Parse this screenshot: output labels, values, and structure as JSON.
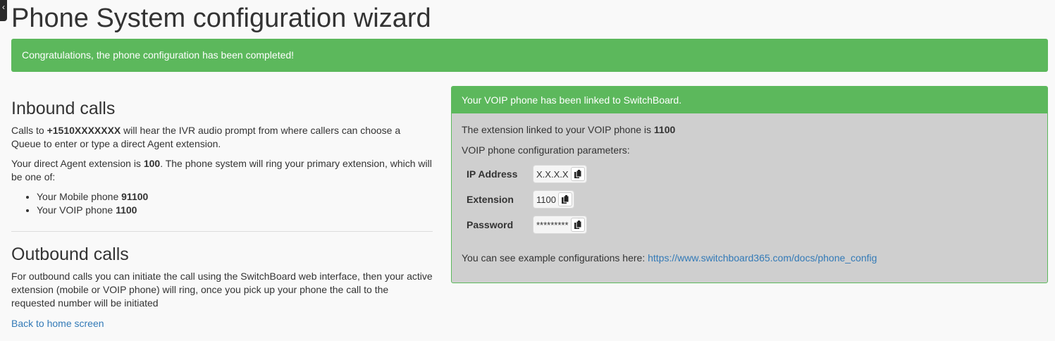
{
  "collapse_tab": {
    "glyph": "‹"
  },
  "page": {
    "title": "Phone System configuration wizard",
    "success_message": "Congratulations, the phone configuration has been completed!"
  },
  "inbound": {
    "heading": "Inbound calls",
    "p1_prefix": "Calls to ",
    "phone_number": "+1510XXXXXXX",
    "p1_suffix": " will hear the IVR audio prompt from where callers can choose a Queue to enter or type a direct Agent extension.",
    "p2_prefix": "Your direct Agent extension is ",
    "agent_extension": "100",
    "p2_suffix": ". The phone system will ring your primary extension, which will be one of:",
    "options": [
      {
        "label": "Your Mobile phone ",
        "value": "91100"
      },
      {
        "label": "Your VOIP phone ",
        "value": "1100"
      }
    ]
  },
  "outbound": {
    "heading": "Outbound calls",
    "text": "For outbound calls you can initiate the call using the SwitchBoard web interface, then your active extension (mobile or VOIP phone) will ring, once you pick up your phone the call to the requested number will be initiated"
  },
  "back_link": "Back to home screen",
  "voip_panel": {
    "heading": "Your VOIP phone has been linked to SwitchBoard.",
    "ext_prefix": "The extension linked to your VOIP phone is ",
    "linked_extension": "1100",
    "params_label": "VOIP phone configuration parameters:",
    "params": {
      "ip": {
        "label": "IP Address",
        "value": "X.X.X.X"
      },
      "ext": {
        "label": "Extension",
        "value": "1100"
      },
      "pwd": {
        "label": "Password",
        "value": "*********"
      }
    },
    "example_prefix": "You can see example configurations here: ",
    "example_url": "https://www.switchboard365.com/docs/phone_config"
  },
  "colors": {
    "success": "#5cb85c",
    "panel_body": "#cfcfcf",
    "link": "#337ab7",
    "text": "#333333"
  },
  "icons": {
    "copy": "copy-clipboard-icon",
    "collapse": "chevron-left-icon"
  }
}
